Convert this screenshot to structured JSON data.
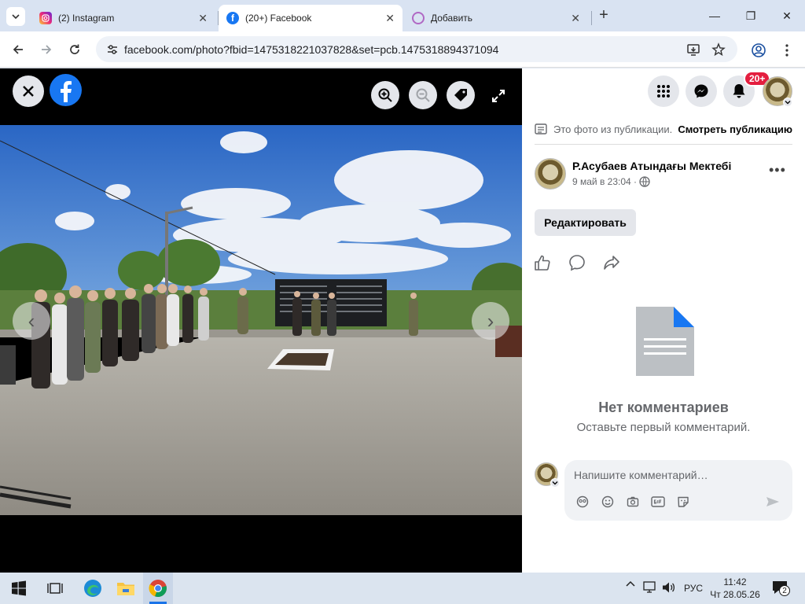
{
  "browser": {
    "tabs": [
      {
        "title": "(2) Instagram",
        "icon": "instagram-icon",
        "active": false
      },
      {
        "title": "(20+) Facebook",
        "icon": "facebook-icon",
        "active": true
      },
      {
        "title": "Добавить",
        "icon": "page-icon",
        "active": false
      }
    ],
    "url": "facebook.com/photo?fbid=1475318221037828&set=pcb.1475318894371094",
    "window_controls": {
      "minimize": "—",
      "maximize": "❐",
      "close": "✕"
    },
    "new_tab": "+"
  },
  "viewer": {
    "prev_arrow": "‹",
    "next_arrow": "›",
    "controls": [
      "zoom-in-icon",
      "zoom-out-icon",
      "tag-icon",
      "fullscreen-icon"
    ]
  },
  "panel": {
    "notification_badge": "20+",
    "notice_text": "Это фото из публикации.",
    "notice_link": "Смотреть публикацию",
    "author": "Р.Асубаев Атындағы Мектебі",
    "date": "9 май в 23:04 ·",
    "more": "•••",
    "edit_button": "Редактировать",
    "no_comments_title": "Нет комментариев",
    "no_comments_sub": "Оставьте первый комментарий.",
    "comment_placeholder": "Напишите комментарий…"
  },
  "taskbar": {
    "lang": "РУС",
    "time": "11:42",
    "date": "Чт 28.05.26",
    "notifications": "2"
  },
  "colors": {
    "facebook_blue": "#1877f2",
    "badge_red": "#e41e3f"
  }
}
